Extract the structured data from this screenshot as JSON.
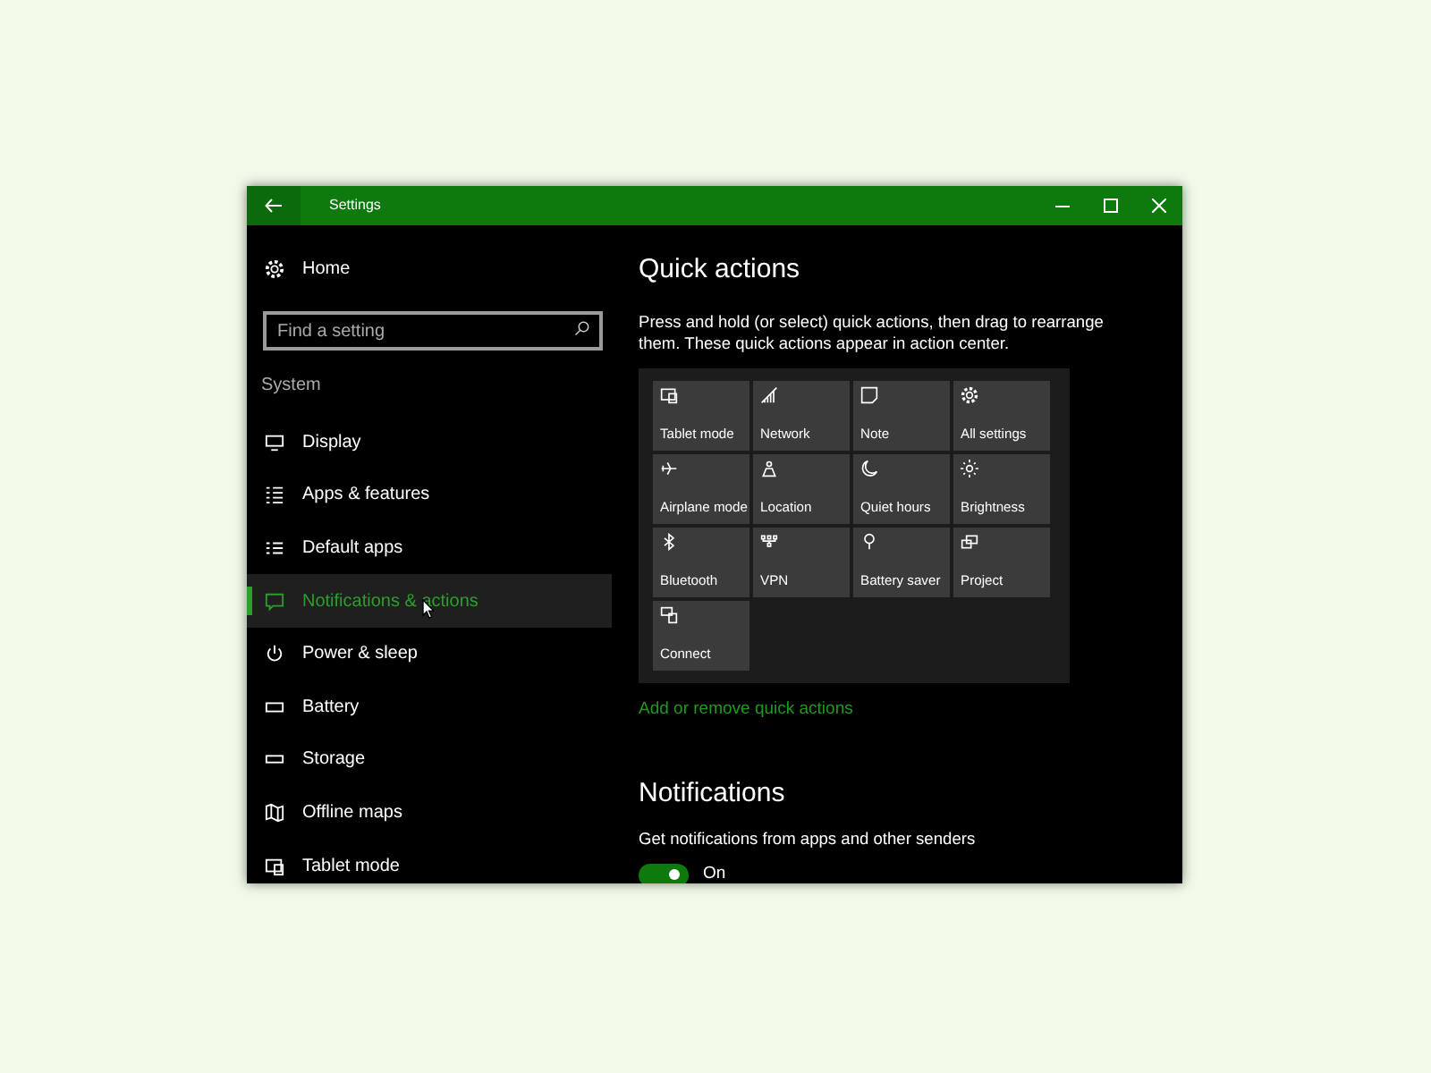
{
  "window": {
    "title": "Settings"
  },
  "sidebar": {
    "home": "Home",
    "search": {
      "placeholder": "Find a setting"
    },
    "section": "System",
    "items": [
      {
        "label": "Display",
        "selected": false
      },
      {
        "label": "Apps & features",
        "selected": false
      },
      {
        "label": "Default apps",
        "selected": false
      },
      {
        "label": "Notifications & actions",
        "selected": true
      },
      {
        "label": "Power & sleep",
        "selected": false
      },
      {
        "label": "Battery",
        "selected": false
      },
      {
        "label": "Storage",
        "selected": false
      },
      {
        "label": "Offline maps",
        "selected": false
      },
      {
        "label": "Tablet mode",
        "selected": false
      }
    ]
  },
  "quick_actions": {
    "title": "Quick actions",
    "description": "Press and hold (or select) quick actions, then drag to rearrange them. These quick actions appear in action center.",
    "tiles": [
      "Tablet mode",
      "Network",
      "Note",
      "All settings",
      "Airplane mode",
      "Location",
      "Quiet hours",
      "Brightness",
      "Bluetooth",
      "VPN",
      "Battery saver",
      "Project",
      "Connect"
    ],
    "link": "Add or remove quick actions"
  },
  "notifications": {
    "title": "Notifications",
    "setting": "Get notifications from apps and other senders",
    "toggle": {
      "on": true,
      "label": "On"
    }
  }
}
